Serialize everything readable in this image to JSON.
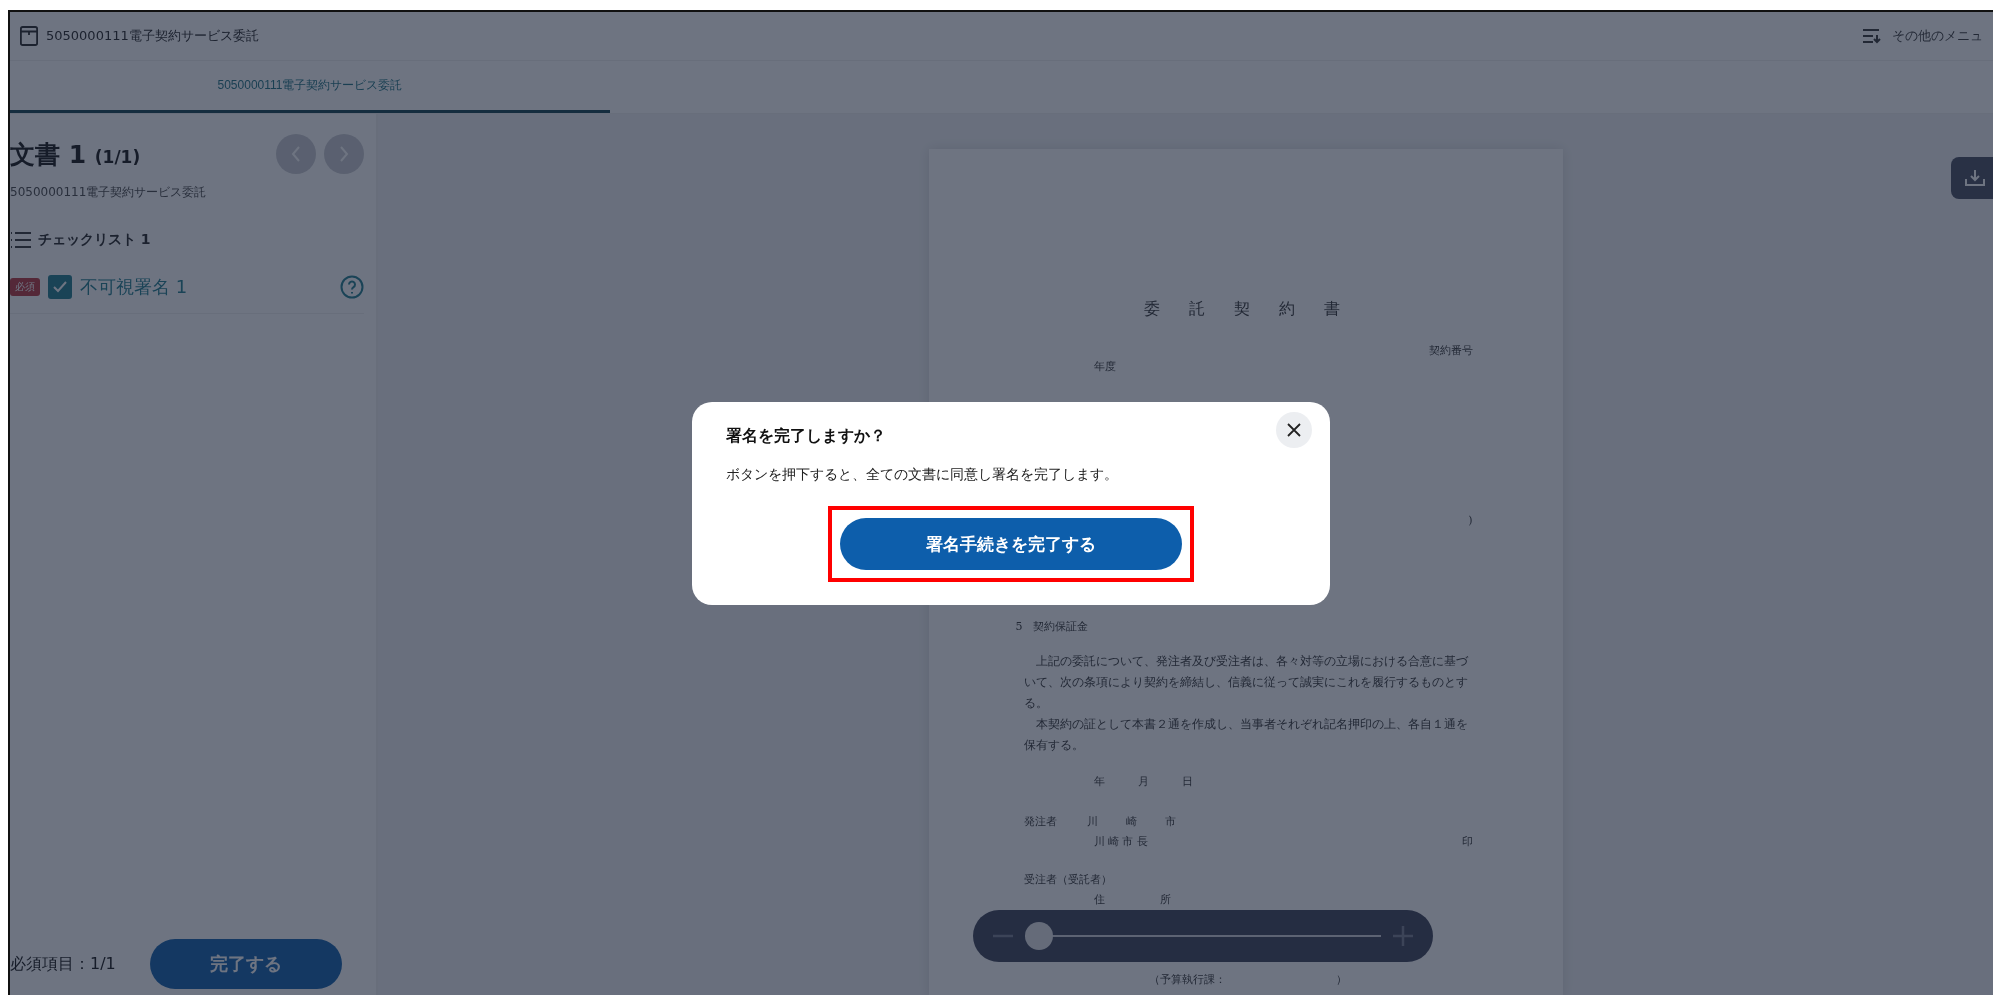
{
  "header": {
    "title": "5050000111電子契約サービス委託",
    "menu_label": "その他のメニュ"
  },
  "tabs": [
    {
      "label": "5050000111電子契約サービス委託",
      "selected": true
    }
  ],
  "sidebar": {
    "heading": "文書 1",
    "count": "(1/1)",
    "subtitle": "5050000111電子契約サービス委託",
    "checklist_title": "チェックリスト 1",
    "items": [
      {
        "badge": "必須",
        "label": "不可視署名 1",
        "checked": true
      }
    ],
    "required_label": "必須項目：1/1",
    "complete_button": "完了する"
  },
  "document": {
    "lines": [
      {
        "kind": "title",
        "text": "委 託 契 約 書"
      },
      {
        "kind": "right",
        "text": "契約番号"
      },
      {
        "kind": "indent",
        "text": "年度"
      },
      {
        "kind": "paren",
        "text": ")"
      },
      {
        "kind": "section",
        "text": "5　契約保証金"
      },
      {
        "kind": "paragraph",
        "text": "　上記の委託について、発注者及び受注者は、各々対等の立場における合意に基づいて、次の条項により契約を締結し、信義に従って誠実にこれを履行するものとする。"
      },
      {
        "kind": "paragraph",
        "text": "　本契約の証として本書２通を作成し、当事者それぞれ記名押印の上、各自１通を保有する。"
      },
      {
        "kind": "date",
        "text": "年　　　月　　　日"
      },
      {
        "kind": "party",
        "label": "発注者",
        "text": "川　　崎　　市"
      },
      {
        "kind": "signer",
        "text": "川 崎 市 長",
        "seal": "印"
      },
      {
        "kind": "party-head",
        "text": "受注者（受託者）"
      },
      {
        "kind": "signer",
        "text": "住　　　　　所"
      },
      {
        "kind": "budget",
        "text": "（予算執行課：　　　　　　　　　　）"
      }
    ]
  },
  "zoom": {
    "level": 0.04
  },
  "dialog": {
    "title": "署名を完了しますか？",
    "message": "ボタンを押下すると、全ての文書に同意し署名を完了します。",
    "confirm_button": "署名手続きを完了する",
    "highlighted": true
  }
}
